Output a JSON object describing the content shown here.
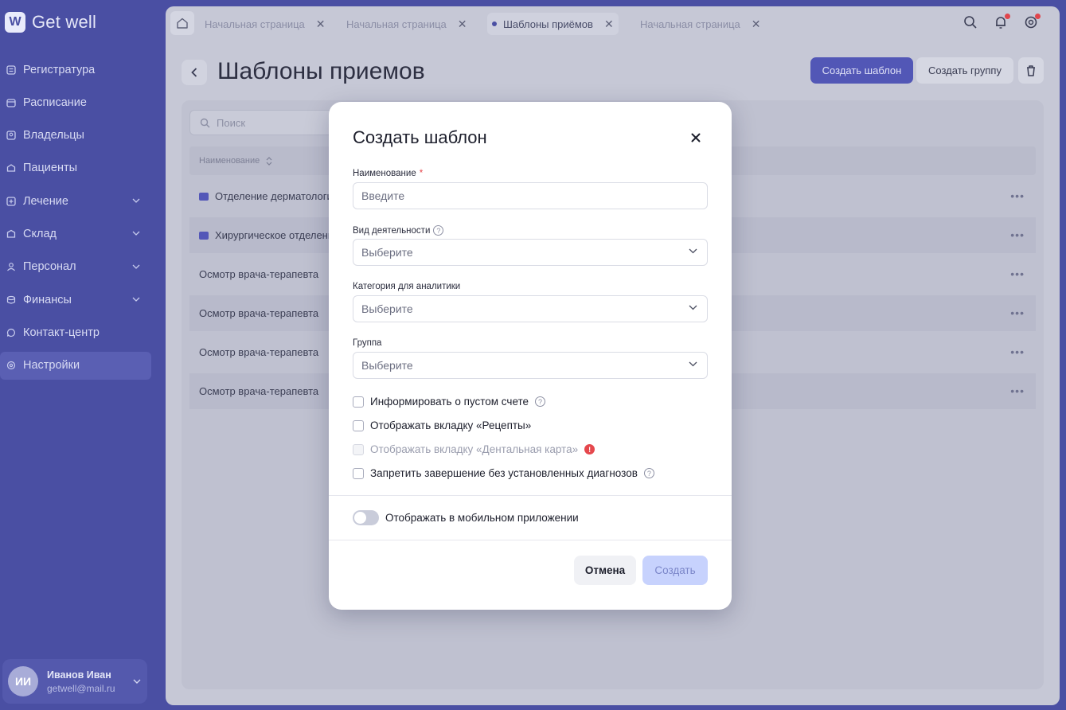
{
  "app": {
    "logo_mark": "W",
    "logo_text": "Get well"
  },
  "sidebar": {
    "items": [
      {
        "label": "Регистратура",
        "icon": "register-icon"
      },
      {
        "label": "Расписание",
        "icon": "calendar-icon"
      },
      {
        "label": "Владельцы",
        "icon": "owners-icon"
      },
      {
        "label": "Пациенты",
        "icon": "patients-icon"
      },
      {
        "label": "Лечение",
        "icon": "treatment-icon"
      },
      {
        "label": "Склад",
        "icon": "warehouse-icon"
      },
      {
        "label": "Персонал",
        "icon": "staff-icon"
      },
      {
        "label": "Финансы",
        "icon": "finance-icon"
      },
      {
        "label": "Контакт-центр",
        "icon": "chat-icon"
      },
      {
        "label": "Настройки",
        "icon": "settings-icon"
      }
    ]
  },
  "user": {
    "initials": "ИИ",
    "name": "Иванов Иван",
    "email": "getwell@mail.ru"
  },
  "tabs": [
    {
      "label": "Начальная страница"
    },
    {
      "label": "Начальная страница"
    },
    {
      "label": "Шаблоны приёмов"
    },
    {
      "label": "Начальная страница"
    }
  ],
  "page": {
    "title": "Шаблоны приемов",
    "create_template": "Создать шаблон",
    "create_group": "Создать группу",
    "search_placeholder": "Поиск",
    "column_name": "Наименование"
  },
  "rows": [
    {
      "label": "Отделение дерматологии"
    },
    {
      "label": "Хирургическое отделение"
    },
    {
      "label": "Осмотр врача-терапевта"
    },
    {
      "label": "Осмотр врача-терапевта"
    },
    {
      "label": "Осмотр врача-терапевта"
    },
    {
      "label": "Осмотр врача-терапевта"
    }
  ],
  "modal": {
    "title": "Создать шаблон",
    "name_label": "Наименование",
    "required_mark": "*",
    "name_placeholder": "Введите",
    "activity_label": "Вид деятельности",
    "activity_value": "Выберите",
    "category_label": "Категория для аналитики",
    "category_value": "Выберите",
    "group_label": "Группа",
    "group_value": "Выберите",
    "check_empty_bill": "Информировать о пустом счете",
    "check_prescriptions": "Отображать вкладку «Рецепты»",
    "check_dental": "Отображать вкладку «Дентальная карта»",
    "check_diagnoses": "Запретить завершение без установленных диагнозов",
    "toggle_mobile": "Отображать в мобильном приложении",
    "cancel": "Отмена",
    "create": "Создать"
  },
  "colors": {
    "sidebar": "#4a4fa3",
    "primary": "#5257b6",
    "create_disabled": "#c7d2fd",
    "alert": "#e5484d"
  }
}
